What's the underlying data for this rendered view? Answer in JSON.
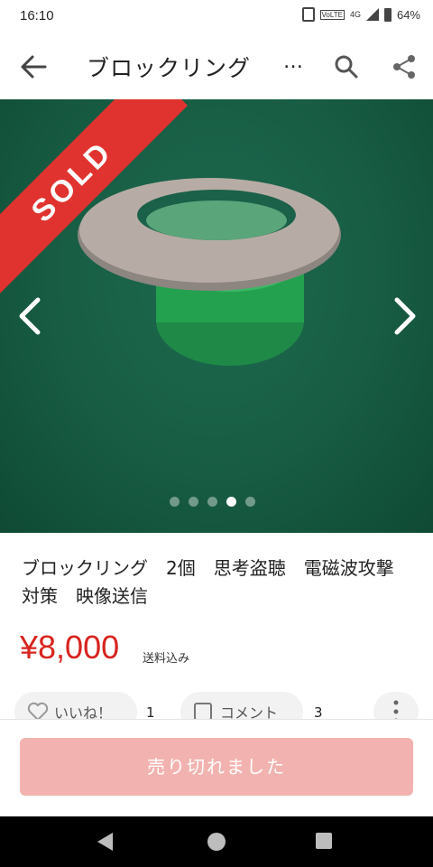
{
  "status_bar": {
    "time": "16:10",
    "network": "4G",
    "volte": "VoLTE",
    "battery": "64%"
  },
  "app_bar": {
    "title": "ブロックリング",
    "ellipsis": "…",
    "back_icon": "arrow-back-icon",
    "search_icon": "search-icon",
    "share_icon": "share-icon"
  },
  "gallery": {
    "sold_badge": "SOLD",
    "image_count": 5,
    "active_index": 3
  },
  "item": {
    "title": "ブロックリング　2個　思考盗聴　電磁波攻撃対策　映像送信",
    "price": "¥8,000",
    "shipping": "送料込み"
  },
  "actions": {
    "like_label": "いいね！",
    "like_count": "1",
    "comment_label": "コメント",
    "comment_count": "3",
    "more_icon": "more-vert-icon"
  },
  "purchase": {
    "button_label": "売り切れました"
  },
  "colors": {
    "price_red": "#d8231e",
    "sold_red": "#e0332f",
    "disabled_button": "#f2b3b0"
  }
}
